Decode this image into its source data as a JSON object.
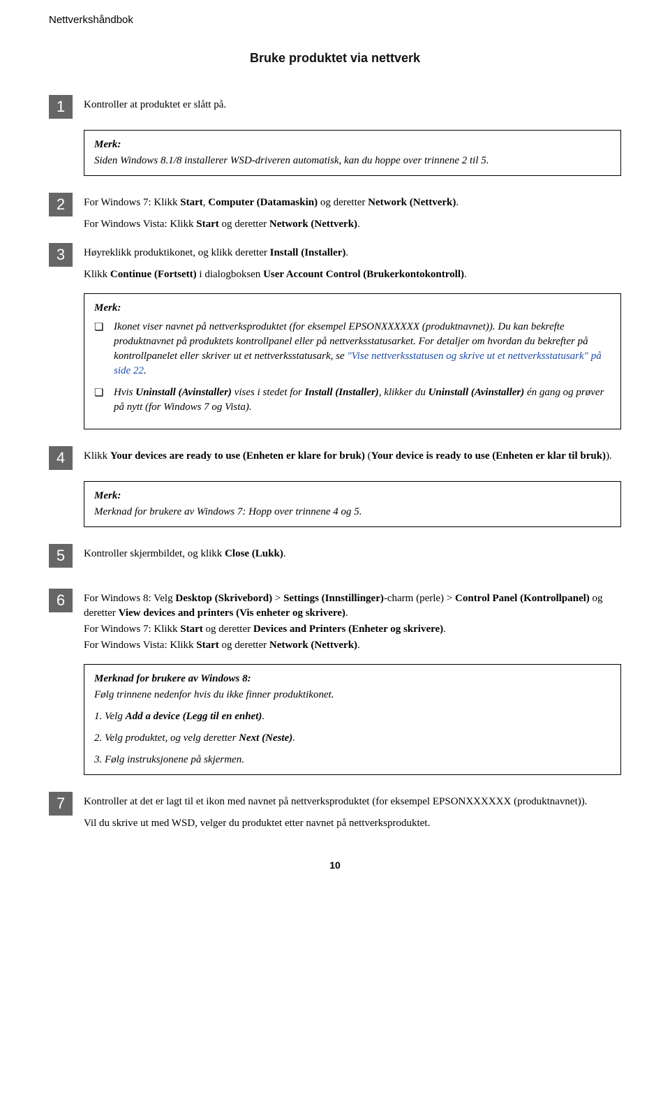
{
  "docTitle": "Nettverkshåndbok",
  "sectionTitle": "Bruke produktet via nettverk",
  "noteLabel": "Merk:",
  "bulletMark": "❏",
  "step1": {
    "num": "1",
    "text": "Kontroller at produktet er slått på.",
    "note": "Siden Windows 8.1/8 installerer WSD-driveren automatisk, kan du hoppe over trinnene 2 til 5."
  },
  "step2": {
    "num": "2",
    "l1a": "For Windows 7: Klikk ",
    "l1b": "Start",
    "l1c": ", ",
    "l1d": "Computer (Datamaskin)",
    "l1e": " og deretter ",
    "l1f": "Network (Nettverk)",
    "l1g": ".",
    "l2a": "For Windows Vista: Klikk ",
    "l2b": "Start",
    "l2c": " og deretter ",
    "l2d": "Network (Nettverk)",
    "l2e": "."
  },
  "step3": {
    "num": "3",
    "l1a": "Høyreklikk produktikonet, og klikk deretter ",
    "l1b": "Install (Installer)",
    "l1c": ".",
    "l2a": "Klikk ",
    "l2b": "Continue (Fortsett)",
    "l2c": " i dialogboksen ",
    "l2d": "User Account Control (Brukerkontokontroll)",
    "l2e": "."
  },
  "noteBig": {
    "b1a": "Ikonet viser navnet på nettverksproduktet (for eksempel EPSONXXXXXX (produktnavnet)). Du kan bekrefte produktnavnet på produktets kontrollpanel eller på nettverksstatusarket. For detaljer om hvordan du bekrefter på kontrollpanelet eller skriver ut et nettverksstatusark, se ",
    "b1link": "\"Vise nettverksstatusen og skrive ut et nettverksstatusark\" på side 22",
    "b1b": ".",
    "b2a": "Hvis ",
    "b2b": "Uninstall (Avinstaller)",
    "b2c": " vises i stedet for ",
    "b2d": "Install (Installer)",
    "b2e": ", klikker du ",
    "b2f": "Uninstall (Avinstaller)",
    "b2g": " én gang og prøver på nytt (for Windows 7 og Vista)."
  },
  "step4": {
    "num": "4",
    "l1a": "Klikk ",
    "l1b": "Your devices are ready to use (Enheten er klare for bruk)",
    "l1c": " (",
    "l1d": "Your device is ready to use (Enheten er klar til bruk)",
    "l1e": ").",
    "note": "Merknad for brukere av Windows 7: Hopp over trinnene 4 og 5."
  },
  "step5": {
    "num": "5",
    "l1a": "Kontroller skjermbildet, og klikk ",
    "l1b": "Close (Lukk)",
    "l1c": "."
  },
  "step6": {
    "num": "6",
    "l1a": "For Windows 8: Velg ",
    "l1b": "Desktop (Skrivebord)",
    "l1c": " > ",
    "l1d": "Settings (Innstillinger)",
    "l1e": "-charm (perle) > ",
    "l1f": "Control Panel (Kontrollpanel)",
    "l1g": " og deretter ",
    "l1h": "View devices and printers (Vis enheter og skrivere)",
    "l1i": ".",
    "l2a": "For Windows 7: Klikk ",
    "l2b": "Start",
    "l2c": " og deretter ",
    "l2d": "Devices and Printers (Enheter og skrivere)",
    "l2e": ".",
    "l3a": "For Windows Vista: Klikk ",
    "l3b": "Start",
    "l3c": " og deretter ",
    "l3d": "Network (Nettverk)",
    "l3e": "."
  },
  "noteW8": {
    "title": "Merknad for brukere av Windows 8:",
    "intro": "Følg trinnene nedenfor hvis du ikke finner produktikonet.",
    "s1a": "1. Velg ",
    "s1b": "Add a device (Legg til en enhet)",
    "s1c": ".",
    "s2a": "2. Velg produktet, og velg deretter ",
    "s2b": "Next (Neste)",
    "s2c": ".",
    "s3": "3. Følg instruksjonene på skjermen."
  },
  "step7": {
    "num": "7",
    "l1": "Kontroller at det er lagt til et ikon med navnet på nettverksproduktet (for eksempel EPSONXXXXXX (produktnavnet)).",
    "l2": "Vil du skrive ut med WSD, velger du produktet etter navnet på nettverksproduktet."
  },
  "pageNumber": "10"
}
